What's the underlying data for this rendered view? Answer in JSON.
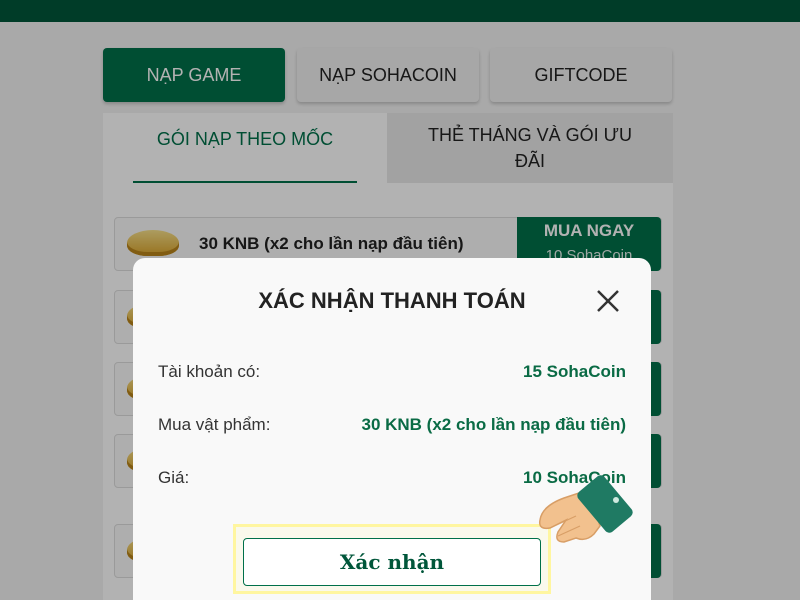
{
  "main_tabs": [
    {
      "label": "NẠP GAME",
      "active": true
    },
    {
      "label": "NẠP SOHACOIN",
      "active": false
    },
    {
      "label": "GIFTCODE",
      "active": false
    }
  ],
  "sub_tabs": [
    {
      "label": "GÓI NẠP THEO MỐC",
      "active": true
    },
    {
      "label": "THẺ THÁNG VÀ GÓI ƯU ĐÃI",
      "active": false
    }
  ],
  "packages": [
    {
      "label": "30 KNB (x2 cho lần nạp đầu tiên)",
      "buy_label": "MUA NGAY",
      "price": "10 SohaCoin"
    }
  ],
  "modal": {
    "title": "XÁC NHẬN THANH TOÁN",
    "rows": [
      {
        "label": "Tài khoản có:",
        "value": "15 SohaCoin"
      },
      {
        "label": "Mua vật phẩm:",
        "value": "30 KNB (x2 cho lần nạp đầu tiên)"
      },
      {
        "label": "Giá:",
        "value": "10 SohaCoin"
      }
    ],
    "confirm_label": "Xác nhận"
  },
  "colors": {
    "brand_green": "#00704a",
    "dark_green": "#00563a",
    "highlight": "#fff6a0"
  },
  "icons": {
    "close": "close-icon",
    "pointer": "pointing-hand-icon",
    "package": "gold-ingot-icon"
  }
}
